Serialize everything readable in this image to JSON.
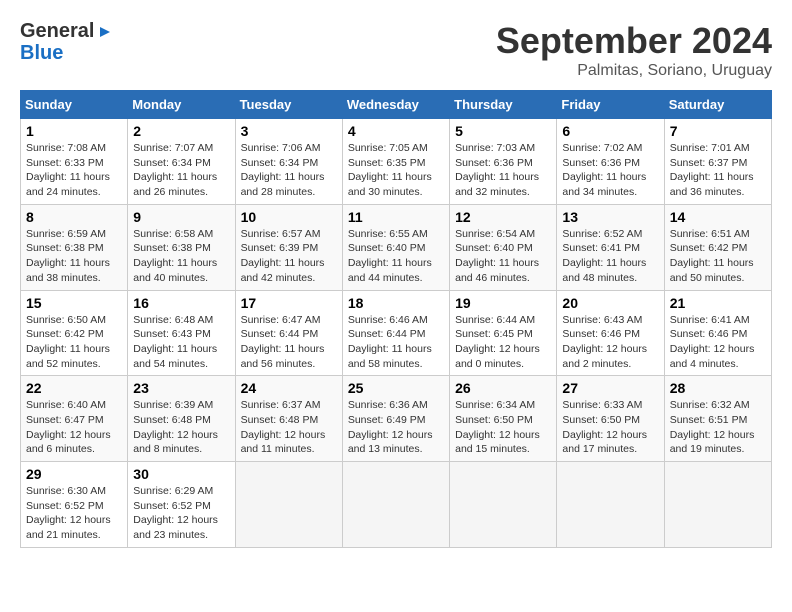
{
  "logo": {
    "line1": "General",
    "line2": "Blue"
  },
  "title": "September 2024",
  "location": "Palmitas, Soriano, Uruguay",
  "days_of_week": [
    "Sunday",
    "Monday",
    "Tuesday",
    "Wednesday",
    "Thursday",
    "Friday",
    "Saturday"
  ],
  "weeks": [
    [
      {
        "day": "1",
        "sunrise": "7:08 AM",
        "sunset": "6:33 PM",
        "daylight": "11 hours and 24 minutes."
      },
      {
        "day": "2",
        "sunrise": "7:07 AM",
        "sunset": "6:34 PM",
        "daylight": "11 hours and 26 minutes."
      },
      {
        "day": "3",
        "sunrise": "7:06 AM",
        "sunset": "6:34 PM",
        "daylight": "11 hours and 28 minutes."
      },
      {
        "day": "4",
        "sunrise": "7:05 AM",
        "sunset": "6:35 PM",
        "daylight": "11 hours and 30 minutes."
      },
      {
        "day": "5",
        "sunrise": "7:03 AM",
        "sunset": "6:36 PM",
        "daylight": "11 hours and 32 minutes."
      },
      {
        "day": "6",
        "sunrise": "7:02 AM",
        "sunset": "6:36 PM",
        "daylight": "11 hours and 34 minutes."
      },
      {
        "day": "7",
        "sunrise": "7:01 AM",
        "sunset": "6:37 PM",
        "daylight": "11 hours and 36 minutes."
      }
    ],
    [
      {
        "day": "8",
        "sunrise": "6:59 AM",
        "sunset": "6:38 PM",
        "daylight": "11 hours and 38 minutes."
      },
      {
        "day": "9",
        "sunrise": "6:58 AM",
        "sunset": "6:38 PM",
        "daylight": "11 hours and 40 minutes."
      },
      {
        "day": "10",
        "sunrise": "6:57 AM",
        "sunset": "6:39 PM",
        "daylight": "11 hours and 42 minutes."
      },
      {
        "day": "11",
        "sunrise": "6:55 AM",
        "sunset": "6:40 PM",
        "daylight": "11 hours and 44 minutes."
      },
      {
        "day": "12",
        "sunrise": "6:54 AM",
        "sunset": "6:40 PM",
        "daylight": "11 hours and 46 minutes."
      },
      {
        "day": "13",
        "sunrise": "6:52 AM",
        "sunset": "6:41 PM",
        "daylight": "11 hours and 48 minutes."
      },
      {
        "day": "14",
        "sunrise": "6:51 AM",
        "sunset": "6:42 PM",
        "daylight": "11 hours and 50 minutes."
      }
    ],
    [
      {
        "day": "15",
        "sunrise": "6:50 AM",
        "sunset": "6:42 PM",
        "daylight": "11 hours and 52 minutes."
      },
      {
        "day": "16",
        "sunrise": "6:48 AM",
        "sunset": "6:43 PM",
        "daylight": "11 hours and 54 minutes."
      },
      {
        "day": "17",
        "sunrise": "6:47 AM",
        "sunset": "6:44 PM",
        "daylight": "11 hours and 56 minutes."
      },
      {
        "day": "18",
        "sunrise": "6:46 AM",
        "sunset": "6:44 PM",
        "daylight": "11 hours and 58 minutes."
      },
      {
        "day": "19",
        "sunrise": "6:44 AM",
        "sunset": "6:45 PM",
        "daylight": "12 hours and 0 minutes."
      },
      {
        "day": "20",
        "sunrise": "6:43 AM",
        "sunset": "6:46 PM",
        "daylight": "12 hours and 2 minutes."
      },
      {
        "day": "21",
        "sunrise": "6:41 AM",
        "sunset": "6:46 PM",
        "daylight": "12 hours and 4 minutes."
      }
    ],
    [
      {
        "day": "22",
        "sunrise": "6:40 AM",
        "sunset": "6:47 PM",
        "daylight": "12 hours and 6 minutes."
      },
      {
        "day": "23",
        "sunrise": "6:39 AM",
        "sunset": "6:48 PM",
        "daylight": "12 hours and 8 minutes."
      },
      {
        "day": "24",
        "sunrise": "6:37 AM",
        "sunset": "6:48 PM",
        "daylight": "12 hours and 11 minutes."
      },
      {
        "day": "25",
        "sunrise": "6:36 AM",
        "sunset": "6:49 PM",
        "daylight": "12 hours and 13 minutes."
      },
      {
        "day": "26",
        "sunrise": "6:34 AM",
        "sunset": "6:50 PM",
        "daylight": "12 hours and 15 minutes."
      },
      {
        "day": "27",
        "sunrise": "6:33 AM",
        "sunset": "6:50 PM",
        "daylight": "12 hours and 17 minutes."
      },
      {
        "day": "28",
        "sunrise": "6:32 AM",
        "sunset": "6:51 PM",
        "daylight": "12 hours and 19 minutes."
      }
    ],
    [
      {
        "day": "29",
        "sunrise": "6:30 AM",
        "sunset": "6:52 PM",
        "daylight": "12 hours and 21 minutes."
      },
      {
        "day": "30",
        "sunrise": "6:29 AM",
        "sunset": "6:52 PM",
        "daylight": "12 hours and 23 minutes."
      },
      null,
      null,
      null,
      null,
      null
    ]
  ]
}
